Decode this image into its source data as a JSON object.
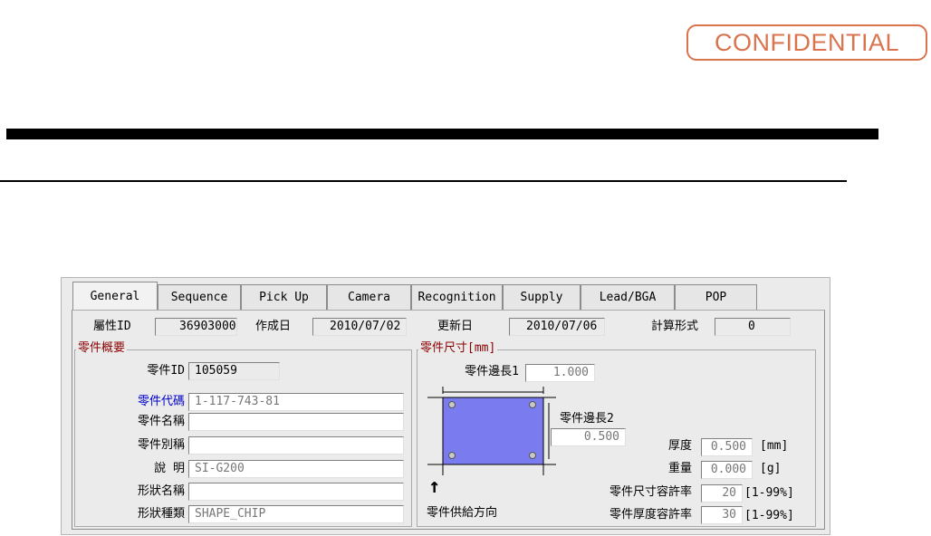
{
  "stamp": "CONFIDENTIAL",
  "tabs": [
    "General",
    "Sequence",
    "Pick Up",
    "Camera",
    "Recognition",
    "Supply",
    "Lead/BGA",
    "POP"
  ],
  "header": {
    "attr_id_label": "屬性ID",
    "attr_id": "36903000",
    "created_label": "作成日",
    "created": "2010/07/02",
    "updated_label": "更新日",
    "updated": "2010/07/06",
    "calc_label": "計算形式",
    "calc": "0"
  },
  "overview": {
    "legend": "零件概要",
    "part_id_label": "零件ID",
    "part_id": "105059",
    "code_label": "零件代碼",
    "code": "1-117-743-81",
    "name_label": "零件名稱",
    "name": "",
    "alias_label": "零件別稱",
    "alias": "",
    "desc_label": "說 明",
    "desc": "SI-G200",
    "shape_name_label": "形狀名稱",
    "shape_name": "",
    "shape_type_label": "形狀種類",
    "shape_type": "SHAPE_CHIP"
  },
  "dimensions": {
    "legend": "零件尺寸[mm]",
    "side1_label": "零件邊長1",
    "side1": "1.000",
    "side2_label": "零件邊長2",
    "side2": "0.500",
    "arrow": "↑",
    "supply_dir_label": "零件供給方向",
    "thickness_label": "厚度",
    "thickness": "0.500",
    "thickness_unit": "[mm]",
    "weight_label": "重量",
    "weight": "0.000",
    "weight_unit": "[g]",
    "size_tol_label": "零件尺寸容許率",
    "size_tol": "20",
    "size_tol_range": "[1-99%]",
    "thick_tol_label": "零件厚度容許率",
    "thick_tol": "30",
    "thick_tol_range": "[1-99%]"
  },
  "colors": {
    "stamp": "#d9744e",
    "legend": "#8b0000",
    "code_label": "#0000cc",
    "part_fill": "#7b7bf0"
  }
}
